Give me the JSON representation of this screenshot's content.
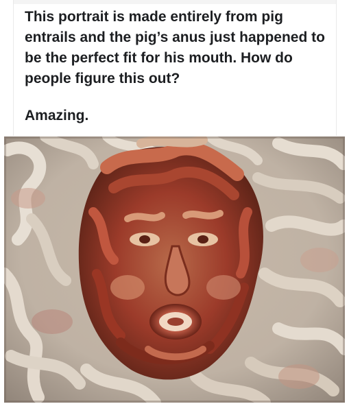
{
  "post": {
    "caption": "This portrait is made entirely from pig entrails and the pig’s anus just happened to be the perfect fit for his mouth. How do people figure this out?",
    "reaction": "Amazing."
  },
  "image": {
    "subject": "portrait made of pig entrails",
    "colors": {
      "background_light": "#d9d2c8",
      "background_mid": "#b8ab9c",
      "face_red": "#a8422f",
      "face_dark": "#5e2418",
      "face_highlight": "#d98c6a"
    }
  }
}
